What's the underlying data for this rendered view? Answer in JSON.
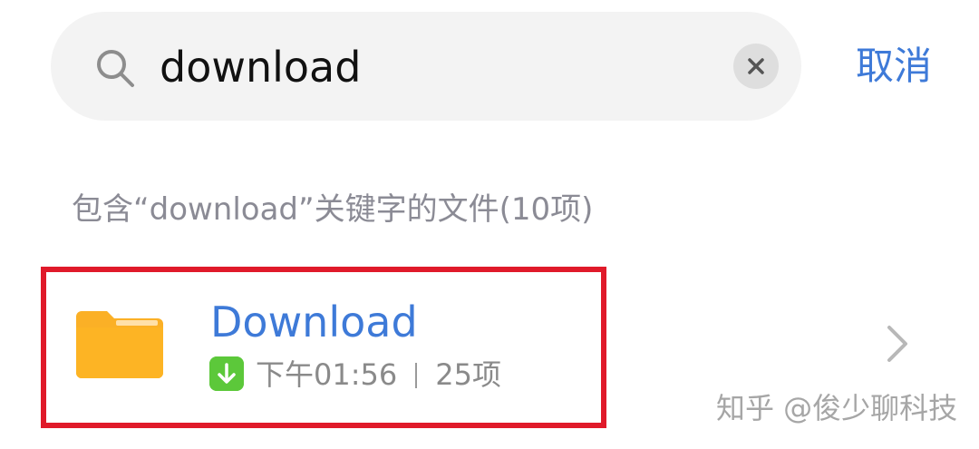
{
  "search": {
    "query": "download",
    "cancel_label": "取消"
  },
  "results": {
    "heading": "包含“download”关键字的文件(10项)",
    "items": [
      {
        "title": "Download",
        "time": "下午01:56",
        "count": "25项",
        "folder_color": "#fbb026",
        "badge_color": "#5cc83a"
      }
    ]
  },
  "watermark": "知乎 @俊少聊科技",
  "colors": {
    "accent": "#3e7ad8",
    "highlight": "#e01a2a"
  }
}
